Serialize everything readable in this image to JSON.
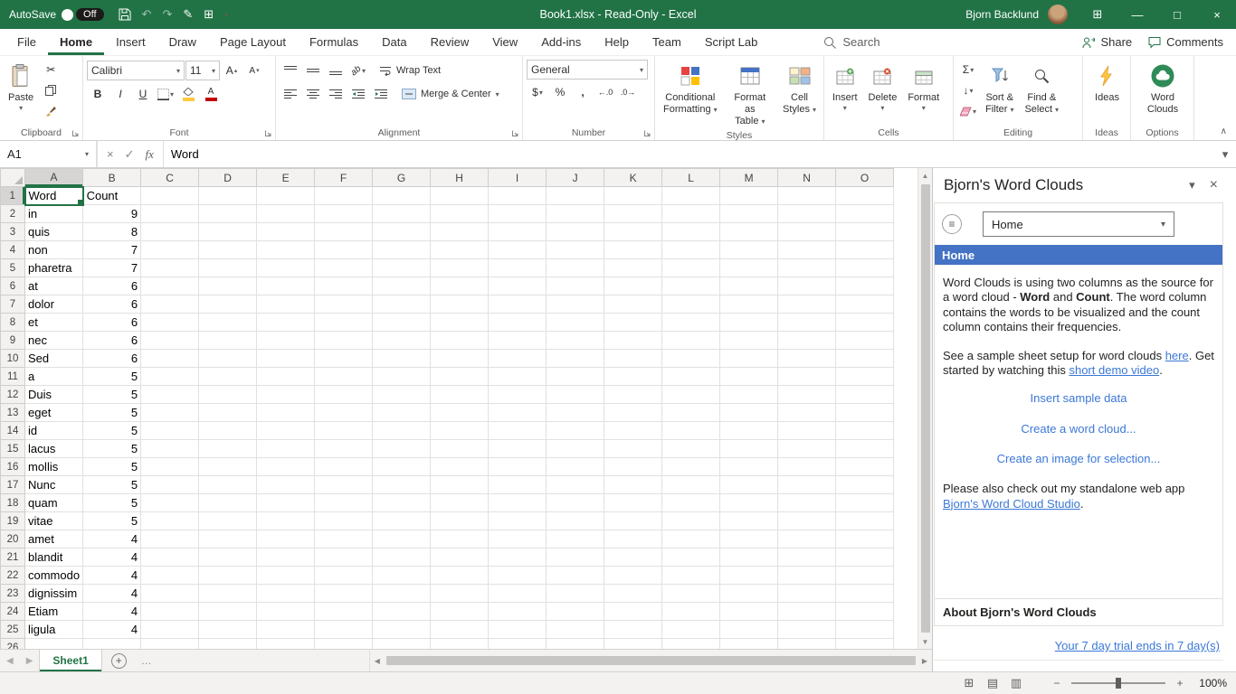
{
  "colors": {
    "excel_green": "#217346",
    "pane_header_blue": "#4472C4",
    "link_blue": "#3B78D7",
    "selection_green": "#217346"
  },
  "titlebar": {
    "autosave_label": "AutoSave",
    "autosave_state": "Off",
    "title": "Book1.xlsx - Read-Only - Excel",
    "user_name": "Bjorn Backlund"
  },
  "tabs": {
    "items": [
      "File",
      "Home",
      "Insert",
      "Draw",
      "Page Layout",
      "Formulas",
      "Data",
      "Review",
      "View",
      "Add-ins",
      "Help",
      "Team",
      "Script Lab"
    ],
    "active": "Home",
    "search_label": "Search",
    "share_label": "Share",
    "comments_label": "Comments"
  },
  "ribbon": {
    "paste_label": "Paste",
    "font_name": "Calibri",
    "font_size": "11",
    "wrap_text_label": "Wrap Text",
    "merge_center_label": "Merge & Center",
    "number_format": "General",
    "conditional_line1": "Conditional",
    "conditional_line2": "Formatting",
    "format_table_line1": "Format as",
    "format_table_line2": "Table",
    "cell_styles_line1": "Cell",
    "cell_styles_line2": "Styles",
    "insert_label": "Insert",
    "delete_label": "Delete",
    "format_label": "Format",
    "sort_line1": "Sort &",
    "sort_line2": "Filter",
    "find_line1": "Find &",
    "find_line2": "Select",
    "ideas_label": "Ideas",
    "wordclouds_line1": "Word",
    "wordclouds_line2": "Clouds",
    "group_labels": {
      "clipboard": "Clipboard",
      "font": "Font",
      "alignment": "Alignment",
      "number": "Number",
      "styles": "Styles",
      "cells": "Cells",
      "editing": "Editing",
      "ideas": "Ideas",
      "options": "Options"
    }
  },
  "formula_bar": {
    "name_box": "A1",
    "fx_label": "fx",
    "value": "Word"
  },
  "grid": {
    "columns": [
      "A",
      "B",
      "C",
      "D",
      "E",
      "F",
      "G",
      "H",
      "I",
      "J",
      "K",
      "L",
      "M",
      "N",
      "O"
    ],
    "selected_cell": "A1",
    "rows": [
      [
        "Word",
        "Count"
      ],
      [
        "in",
        "9"
      ],
      [
        "quis",
        "8"
      ],
      [
        "non",
        "7"
      ],
      [
        "pharetra",
        "7"
      ],
      [
        "at",
        "6"
      ],
      [
        "dolor",
        "6"
      ],
      [
        "et",
        "6"
      ],
      [
        "nec",
        "6"
      ],
      [
        "Sed",
        "6"
      ],
      [
        "a",
        "5"
      ],
      [
        "Duis",
        "5"
      ],
      [
        "eget",
        "5"
      ],
      [
        "id",
        "5"
      ],
      [
        "lacus",
        "5"
      ],
      [
        "mollis",
        "5"
      ],
      [
        "Nunc",
        "5"
      ],
      [
        "quam",
        "5"
      ],
      [
        "vitae",
        "5"
      ],
      [
        "amet",
        "4"
      ],
      [
        "blandit",
        "4"
      ],
      [
        "commodo",
        "4"
      ],
      [
        "dignissim",
        "4"
      ],
      [
        "Etiam",
        "4"
      ],
      [
        "ligula",
        "4"
      ]
    ]
  },
  "sheet_bar": {
    "sheet_tab": "Sheet1"
  },
  "status_bar": {
    "zoom": "100%"
  },
  "pane": {
    "title": "Bjorn's Word Clouds",
    "nav_value": "Home",
    "section_header": "Home",
    "p1_a": "Word Clouds is using two columns as the source for a word cloud - ",
    "p1_bold1": "Word",
    "p1_b": " and ",
    "p1_bold2": "Count",
    "p1_c": ". The word column contains the words to be visualized and the count column contains their frequencies.",
    "p2_a": "See a sample sheet setup for word clouds ",
    "p2_link1": "here",
    "p2_b": ". Get started by watching this ",
    "p2_link2": "short demo video",
    "p2_c": ".",
    "action_link1": "Insert sample data",
    "action_link2": "Create a word cloud...",
    "action_link3": "Create an image for selection...",
    "p3_a": "Please also check out my standalone web app ",
    "p3_link": "Bjorn's Word Cloud Studio",
    "p3_b": ".",
    "about_header": "About Bjorn's Word Clouds",
    "trial_link": "Your 7 day trial ends in 7 day(s)"
  },
  "icons": {
    "cut": "✂",
    "undo": "↶",
    "redo": "↷",
    "ink": "✎",
    "chevron_down": "▾",
    "chevron_up": "▴",
    "close": "×",
    "minimize": "—",
    "maximize": "□",
    "menu": "≡",
    "bold": "B",
    "italic": "I",
    "underline": "U",
    "sigma": "Σ",
    "dollar": "$",
    "percent": "%",
    "comma": ",",
    "increase_decimal": "←.0",
    "decrease_decimal": ".0→",
    "fill_down": "↓",
    "letter_a": "A",
    "arrow_left_small": "◂",
    "arrow_right_small": "▸",
    "scroll_up": "▲",
    "scroll_down": "▼",
    "scroll_left": "◀",
    "scroll_right": "▶",
    "plus": "+",
    "minus": "−",
    "dots": "…",
    "display_options": "⊞",
    "view_normal": "⊞",
    "view_layout": "▤",
    "view_break": "▥",
    "ribbon_collapse": "∧",
    "orientation_ab": "ab",
    "cancel": "×",
    "enter": "✓"
  }
}
